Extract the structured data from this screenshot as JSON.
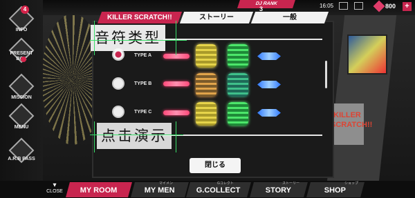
{
  "topbar": {
    "dj_rank_label": "DJ RANK",
    "dj_rank_value": "3",
    "time": "16:05",
    "currency_value": "800",
    "plus_label": "+"
  },
  "left_menu": {
    "badge_count": "4",
    "items": [
      {
        "label": "INFO"
      },
      {
        "label": "PRESENT BOX"
      },
      {
        "label": "MISSION"
      },
      {
        "label": "MENU"
      },
      {
        "label": "A.R.B PASS"
      }
    ]
  },
  "dialog": {
    "tabs": [
      {
        "label": "KILLER SCRATCH!!"
      },
      {
        "label": "ストーリー"
      },
      {
        "label": "一般"
      }
    ],
    "rows": [
      {
        "label": "TYPE A",
        "selected": true
      },
      {
        "label": "TYPE B",
        "selected": false
      },
      {
        "label": "TYPE C",
        "selected": false
      }
    ],
    "close_label": "閉じる"
  },
  "annotations": {
    "note_type": "音符类型",
    "tap_demo": "点击演示"
  },
  "background": {
    "card_text": "KILLER SCRATCH!!"
  },
  "bottom_nav": {
    "close_label": "CLOSE",
    "tabs": [
      {
        "label": "MY ROOM",
        "sub": ""
      },
      {
        "label": "MY MEN",
        "sub": "マイメン"
      },
      {
        "label": "G.COLLECT",
        "sub": "Gコレクト"
      },
      {
        "label": "STORY",
        "sub": "ストーリー"
      },
      {
        "label": "SHOP",
        "sub": "ショップ"
      }
    ]
  },
  "colors": {
    "accent": "#c8254f",
    "note_pink": "#ff4a7a",
    "note_yellow": "#e6d44a",
    "note_green": "#4ce66a",
    "note_blue": "#2f78ff"
  }
}
